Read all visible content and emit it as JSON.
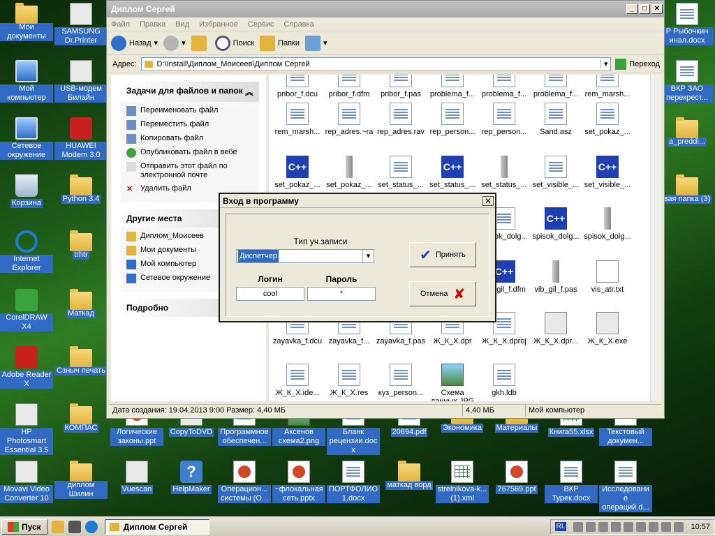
{
  "desktop": {
    "icons": [
      {
        "label": "Мои документы",
        "icon": "folder-docs-icon"
      },
      {
        "label": "SAMSUNG Dr.Printer",
        "icon": "printer-icon"
      },
      {
        "label": "Мой компьютер",
        "icon": "computer-icon"
      },
      {
        "label": "USB-модем Билайн",
        "icon": "modem-icon"
      },
      {
        "label": "Сетевое окружение",
        "icon": "network-icon"
      },
      {
        "label": "HUAWEI Modem 3.0",
        "icon": "huawei-icon"
      },
      {
        "label": "Корзина",
        "icon": "recycle-bin-icon"
      },
      {
        "label": "Python 3.4",
        "icon": "folder-icon"
      },
      {
        "label": "Internet Explorer",
        "icon": "ie-icon"
      },
      {
        "label": "trhtr",
        "icon": "folder-icon"
      },
      {
        "label": "CorelDRAW X4",
        "icon": "coreldraw-icon"
      },
      {
        "label": "Маткад",
        "icon": "folder-icon"
      },
      {
        "label": "Adobe Reader X",
        "icon": "adobe-reader-icon"
      },
      {
        "label": "Сзныч печать",
        "icon": "folder-icon"
      },
      {
        "label": "HP Photosmart Essential 3.5",
        "icon": "hp-icon"
      },
      {
        "label": "КОМПАС",
        "icon": "folder-icon"
      },
      {
        "label": "Логические законы.ppt",
        "icon": "ppt-icon"
      },
      {
        "label": "CopyToDVD",
        "icon": "dvd-icon"
      },
      {
        "label": "Программное обеспечен...",
        "icon": "doc-icon"
      },
      {
        "label": "Аксенов схема2.png",
        "icon": "image-icon"
      },
      {
        "label": "Бланк рецензии.docx",
        "icon": "doc-icon"
      },
      {
        "label": "20694.pdf",
        "icon": "pdf-icon"
      },
      {
        "label": "Экономика",
        "icon": "folder-icon"
      },
      {
        "label": "Материалы",
        "icon": "folder-icon"
      },
      {
        "label": "Книга55.xlsx",
        "icon": "xls-icon"
      },
      {
        "label": "Текстовый докумен...",
        "icon": "text-icon"
      },
      {
        "label": "Movavi Video Converter 10",
        "icon": "movavi-icon"
      },
      {
        "label": "диплом Шилин",
        "icon": "folder-icon"
      },
      {
        "label": "Vuescan",
        "icon": "vuescan-icon"
      },
      {
        "label": "HelpMaker",
        "icon": "help-icon"
      },
      {
        "label": "Операцион... системы (О...",
        "icon": "ppt-icon"
      },
      {
        "label": "~флокальная сеть.pptx",
        "icon": "ppt-icon"
      },
      {
        "label": "ПОРТФОЛИО 1.docx",
        "icon": "doc-icon"
      },
      {
        "label": "маткад ворд",
        "icon": "folder-icon"
      },
      {
        "label": "strelnikova-k... (1).xml",
        "icon": "xml-icon"
      },
      {
        "label": "767569.ppt",
        "icon": "ppt-icon"
      },
      {
        "label": "ВКР Турек.docx",
        "icon": "doc-icon"
      },
      {
        "label": "Исследование операций.d...",
        "icon": "doc-icon"
      },
      {
        "label": "Р Рыбочкин инал.docx",
        "icon": "doc-icon"
      },
      {
        "label": "ВКР ЗАО перекрест...",
        "icon": "doc-icon"
      },
      {
        "label": "a_preddi...",
        "icon": "folder-icon"
      },
      {
        "label": "вая папка (3)",
        "icon": "folder-icon"
      }
    ]
  },
  "window": {
    "title": "Диплом Сергей",
    "menu": [
      "Файл",
      "Правка",
      "Вид",
      "Избранное",
      "Сервис",
      "Справка"
    ],
    "toolbar": {
      "back": "Назад",
      "search": "Поиск",
      "folders": "Папки"
    },
    "address": {
      "label": "Адрес:",
      "value": "D:\\Install\\Диплом_Моисеев\\Диплом Сергей",
      "go": "Переход"
    },
    "tasks": {
      "title": "Задачи для файлов и папок",
      "items": [
        "Переименовать файл",
        "Переместить файл",
        "Копировать файл",
        "Опубликовать файл в вебе",
        "Отправить этот файл по электронной почте",
        "Удалить файл"
      ]
    },
    "places": {
      "title": "Другие места",
      "items": [
        "Диплом_Моисеев",
        "Мои документы",
        "Мой компьютер",
        "Сетевое окружение"
      ]
    },
    "details": {
      "title": "Подробно"
    },
    "files": [
      {
        "name": "pribor_f.dcu",
        "icon": "doc-icon"
      },
      {
        "name": "pribor_f.dfm",
        "icon": "doc-icon"
      },
      {
        "name": "pribor_f.pas",
        "icon": "doc-icon"
      },
      {
        "name": "problema_f...",
        "icon": "doc-icon"
      },
      {
        "name": "problema_f...",
        "icon": "doc-icon"
      },
      {
        "name": "problema_f...",
        "icon": "doc-icon"
      },
      {
        "name": "rem_marsh...",
        "icon": "doc-icon"
      },
      {
        "name": "rem_marsh...",
        "icon": "doc-icon"
      },
      {
        "name": "rep_adres.~ra",
        "icon": "doc-icon"
      },
      {
        "name": "rep_adres.rav",
        "icon": "doc-icon"
      },
      {
        "name": "rep_person...",
        "icon": "doc-icon"
      },
      {
        "name": "rep_person...",
        "icon": "doc-icon"
      },
      {
        "name": "Sand.asz",
        "icon": "doc-icon"
      },
      {
        "name": "set_pokaz_...",
        "icon": "doc-icon"
      },
      {
        "name": "set_pokaz_...",
        "icon": "cpp-icon"
      },
      {
        "name": "set_pokaz_...",
        "icon": "res-icon"
      },
      {
        "name": "set_status_...",
        "icon": "doc-icon"
      },
      {
        "name": "set_status_...",
        "icon": "cpp-icon"
      },
      {
        "name": "set_status_...",
        "icon": "res-icon"
      },
      {
        "name": "set_visible_...",
        "icon": "doc-icon"
      },
      {
        "name": "set_visible_...",
        "icon": "cpp-icon"
      },
      {
        "name": "spisok_dolg...",
        "icon": "doc-icon"
      },
      {
        "name": "spisok_dolg...",
        "icon": "cpp-icon"
      },
      {
        "name": "spisok_dolg...",
        "icon": "res-icon"
      },
      {
        "name": "vib_gil_f.dfm",
        "icon": "cpp-icon"
      },
      {
        "name": "vib_gil_f.pas",
        "icon": "res-icon"
      },
      {
        "name": "vis_atr.txt",
        "icon": "text-icon"
      },
      {
        "name": "zayavka_f.dcu",
        "icon": "doc-icon"
      },
      {
        "name": "zayavka_f...",
        "icon": "doc-icon"
      },
      {
        "name": "zayavka_f.pas",
        "icon": "doc-icon"
      },
      {
        "name": "Ж_К_Х.dpr",
        "icon": "doc-icon"
      },
      {
        "name": "Ж_К_Х.dproj",
        "icon": "doc-icon"
      },
      {
        "name": "Ж_К_Х.dpr...",
        "icon": "exe-icon"
      },
      {
        "name": "Ж_К_Х.exe",
        "icon": "app-icon"
      },
      {
        "name": "Ж_К_Х.ide...",
        "icon": "doc-icon"
      },
      {
        "name": "Ж_К_Х.res",
        "icon": "doc-icon"
      },
      {
        "name": "куз_person...",
        "icon": "doc-icon"
      },
      {
        "name": "Схема данных.JPG",
        "icon": "image-icon"
      },
      {
        "name": "gkh.ldb",
        "icon": "ldb-icon"
      }
    ],
    "status": {
      "info": "Дата создания: 19.04.2013 9:00 Размер: 4,40 МБ",
      "size": "4,40 МБ",
      "location": "Мой компьютер"
    }
  },
  "dialog": {
    "title": "Вход в программу",
    "account_type_label": "Тип уч.записи",
    "account_type_value": "Диспетчер",
    "login_label": "Логин",
    "login_value": "cool",
    "password_label": "Пароль",
    "password_value": "*",
    "ok_label": "Принять",
    "cancel_label": "Отмена"
  },
  "taskbar": {
    "start": "Пуск",
    "window": "Диплом Сергей",
    "lang": "RL",
    "clock": "10:57"
  }
}
